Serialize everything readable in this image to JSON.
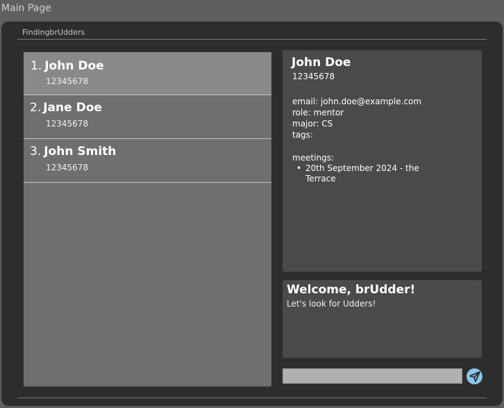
{
  "window": {
    "title": "Main Page"
  },
  "app": {
    "title": "FindingbrUdders"
  },
  "list": [
    {
      "index": "1.",
      "name": "John Doe",
      "phone": "12345678",
      "selected": true
    },
    {
      "index": "2.",
      "name": "Jane Doe",
      "phone": "12345678",
      "selected": false
    },
    {
      "index": "3.",
      "name": "John Smith",
      "phone": "12345678",
      "selected": false
    }
  ],
  "details": {
    "name": "John Doe",
    "phone": "12345678",
    "email": "email: john.doe@example.com",
    "role": "role: mentor",
    "major": "major: CS",
    "tags": "tags:",
    "meetings_label": "meetings:",
    "meetings": [
      "20th September 2024 - the Terrace"
    ]
  },
  "welcome": {
    "title": "Welcome, brUdder!",
    "subtitle": "Let's look for Udders!"
  },
  "command": {
    "value": "",
    "placeholder": ""
  },
  "icons": {
    "send": "send-icon"
  },
  "colors": {
    "send_button": "#8ec5e8",
    "selected_row": "#898989"
  }
}
